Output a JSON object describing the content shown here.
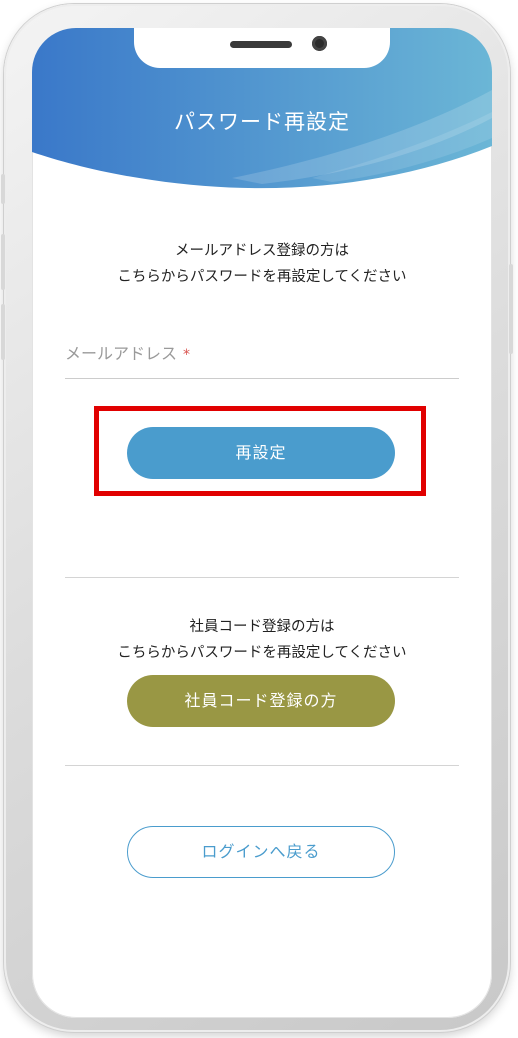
{
  "header": {
    "title": "パスワード再設定"
  },
  "email_section": {
    "intro_line1": "メールアドレス登録の方は",
    "intro_line2": "こちらからパスワードを再設定してください",
    "field_label": "メールアドレス",
    "required_mark": "*",
    "submit_label": "再設定"
  },
  "employee_section": {
    "intro_line1": "社員コード登録の方は",
    "intro_line2": "こちらからパスワードを再設定してください",
    "button_label": "社員コード登録の方"
  },
  "footer": {
    "back_label": "ログインへ戻る"
  },
  "colors": {
    "header_gradient_start": "#3a78c9",
    "header_gradient_end": "#6bb6d6",
    "primary": "#4a9ccd",
    "olive": "#999744",
    "highlight": "#e10000"
  }
}
